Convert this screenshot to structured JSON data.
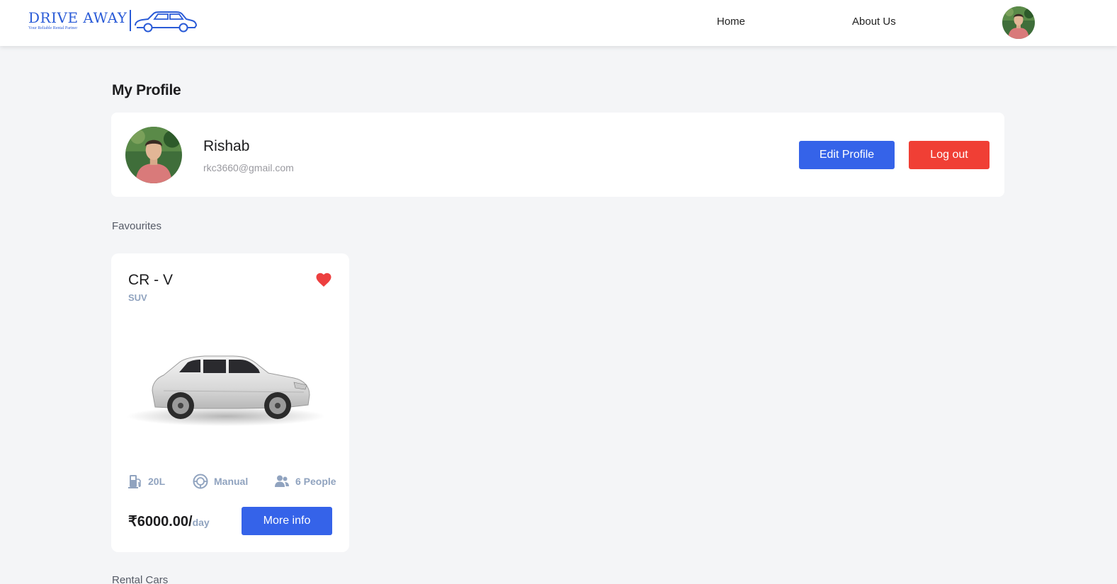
{
  "brand": {
    "name": "DRIVE AWAY",
    "tagline": "Your Reliable Rental Partner",
    "color": "#2a5bd7"
  },
  "nav": {
    "home": "Home",
    "about": "About Us"
  },
  "page": {
    "title": "My Profile"
  },
  "profile": {
    "name": "Rishab",
    "email": "rkc3660@gmail.com",
    "edit_label": "Edit Profile",
    "logout_label": "Log out"
  },
  "sections": {
    "favourites": "Favourites",
    "rented": "Rental Cars"
  },
  "favourites": [
    {
      "name": "CR - V",
      "type": "SUV",
      "fuel": "20L",
      "transmission": "Manual",
      "capacity": "6 People",
      "price": "₹6000.00/",
      "price_unit": "day",
      "favourited": true,
      "more_label": "More info"
    }
  ],
  "colors": {
    "primary": "#3563e9",
    "danger": "#f03f35",
    "muted": "#90a3bf",
    "heart": "#ed3f3f",
    "background": "#f4f5f7"
  },
  "icons": {
    "fuel": "gas-station-icon",
    "transmission": "steering-wheel-icon",
    "capacity": "people-icon",
    "favourite": "heart-icon"
  }
}
